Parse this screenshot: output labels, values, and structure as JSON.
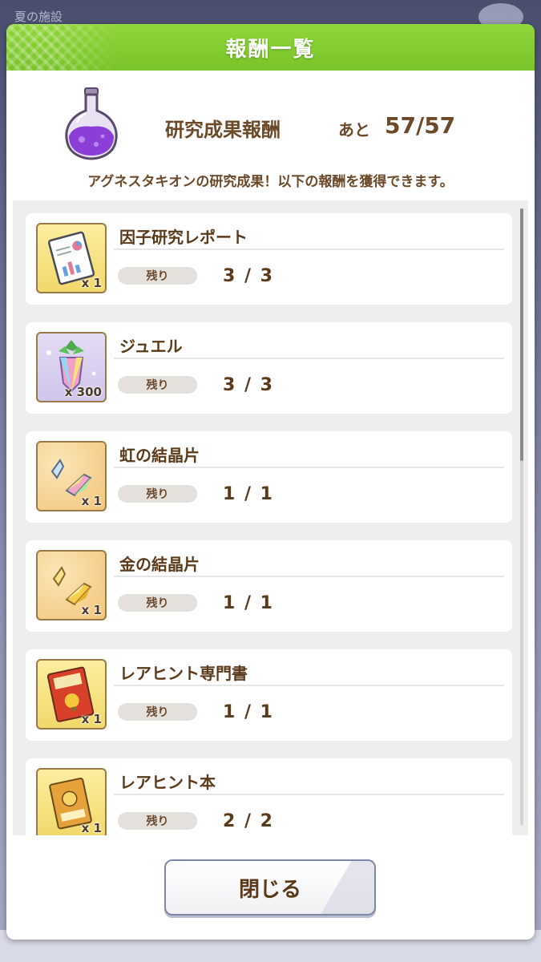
{
  "background": {
    "top_left_text": "夏の施設"
  },
  "dialog": {
    "title": "報酬一覧",
    "reward_type": "研究成果報酬",
    "remaining_label": "あと",
    "remaining_value": "57/57",
    "description": "アグネスタキオンの研究成果！以下の報酬を獲得できます。",
    "close_label": "閉じる"
  },
  "rewards": [
    {
      "name": "因子研究レポート",
      "qty": "x 1",
      "remain_label": "残り",
      "count": "3 / 3",
      "icon": "report-icon"
    },
    {
      "name": "ジュエル",
      "qty": "x 300",
      "remain_label": "残り",
      "count": "3 / 3",
      "icon": "jewel-icon"
    },
    {
      "name": "虹の結晶片",
      "qty": "x 1",
      "remain_label": "残り",
      "count": "1 / 1",
      "icon": "rainbow-crystal-icon"
    },
    {
      "name": "金の結晶片",
      "qty": "x 1",
      "remain_label": "残り",
      "count": "1 / 1",
      "icon": "gold-crystal-icon"
    },
    {
      "name": "レアヒント専門書",
      "qty": "x 1",
      "remain_label": "残り",
      "count": "1 / 1",
      "icon": "hint-book-icon"
    },
    {
      "name": "レアヒント本",
      "qty": "x 1",
      "remain_label": "残り",
      "count": "2 / 2",
      "icon": "hint-book-small-icon"
    }
  ],
  "colors": {
    "header": "#79c42a",
    "text": "#6b4a2a",
    "badge": "#e4e1dd"
  }
}
